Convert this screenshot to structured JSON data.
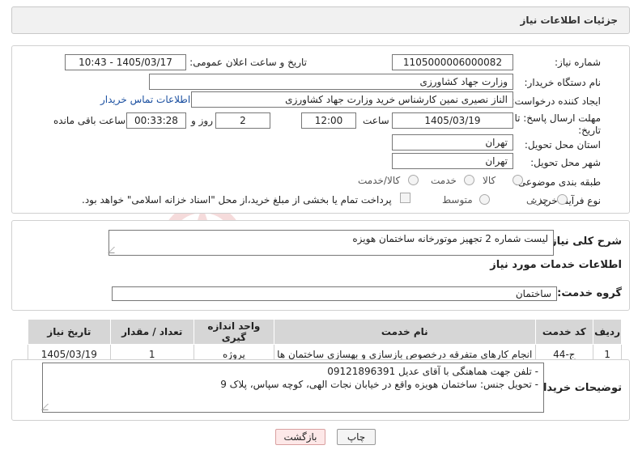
{
  "header": {
    "title": "جزئیات اطلاعات نیاز"
  },
  "form": {
    "need_number_label": "شماره نیاز:",
    "need_number": "1105000006000082",
    "announce_label": "تاریخ و ساعت اعلان عمومی:",
    "announce_value": "1405/03/17 - 10:43",
    "buyer_org_label": "نام دستگاه خریدار:",
    "buyer_org": "وزارت جهاد کشاورزی",
    "creator_label": "ایجاد کننده درخواست:",
    "creator": "الناز نصیری نمین کارشناس خرید وزارت جهاد کشاورزی",
    "contact_link": "اطلاعات تماس خریدار",
    "deadline_label": "مهلت ارسال پاسخ: تا تاریخ:",
    "deadline_date": "1405/03/19",
    "time_label": "ساعت",
    "deadline_time": "12:00",
    "days_value": "2",
    "days_label": "روز و",
    "remaining_value": "00:33:28",
    "remaining_label": "ساعت باقی مانده",
    "province_label": "استان محل تحویل:",
    "province": "تهران",
    "city_label": "شهر محل تحویل:",
    "city": "تهران",
    "category_label": "طبقه بندی موضوعی:",
    "category_options": [
      "کالا",
      "خدمت",
      "کالا/خدمت"
    ],
    "process_label": "نوع فرآیند خرید :",
    "process_options": [
      "جزیی",
      "متوسط"
    ],
    "payment_text": "پرداخت تمام یا بخشی از مبلغ خرید،از محل \"اسناد خزانه اسلامی\" خواهد بود."
  },
  "summary": {
    "label": "شرح کلی نیاز:",
    "text": "لیست شماره 2 تجهیز موتورخانه ساختمان هویزه"
  },
  "services": {
    "section_title": "اطلاعات خدمات مورد نیاز",
    "group_label": "گروه خدمت:",
    "group_value": "ساختمان",
    "columns": [
      "ردیف",
      "کد خدمت",
      "نام خدمت",
      "واحد اندازه گیری",
      "تعداد / مقدار",
      "تاریخ نیاز"
    ],
    "rows": [
      [
        "1",
        "ج-44",
        "انجام کارهای متفرقه درخصوص بازسازی و بهسازی ساختمان ها",
        "پروژه",
        "1",
        "1405/03/19"
      ]
    ]
  },
  "notes": {
    "label": "توضیحات خریدار:",
    "lines": [
      "-    تلفن جهت هماهنگی با آقای عدیل 09121896391",
      "-    تحویل جنس: ساختمان هویزه واقع در خیابان نجات الهی، کوچه سپاس، پلاک 9"
    ]
  },
  "buttons": {
    "print": "چاپ",
    "back": "بازگشت"
  },
  "watermark": {
    "text": "AriaTender.net"
  }
}
